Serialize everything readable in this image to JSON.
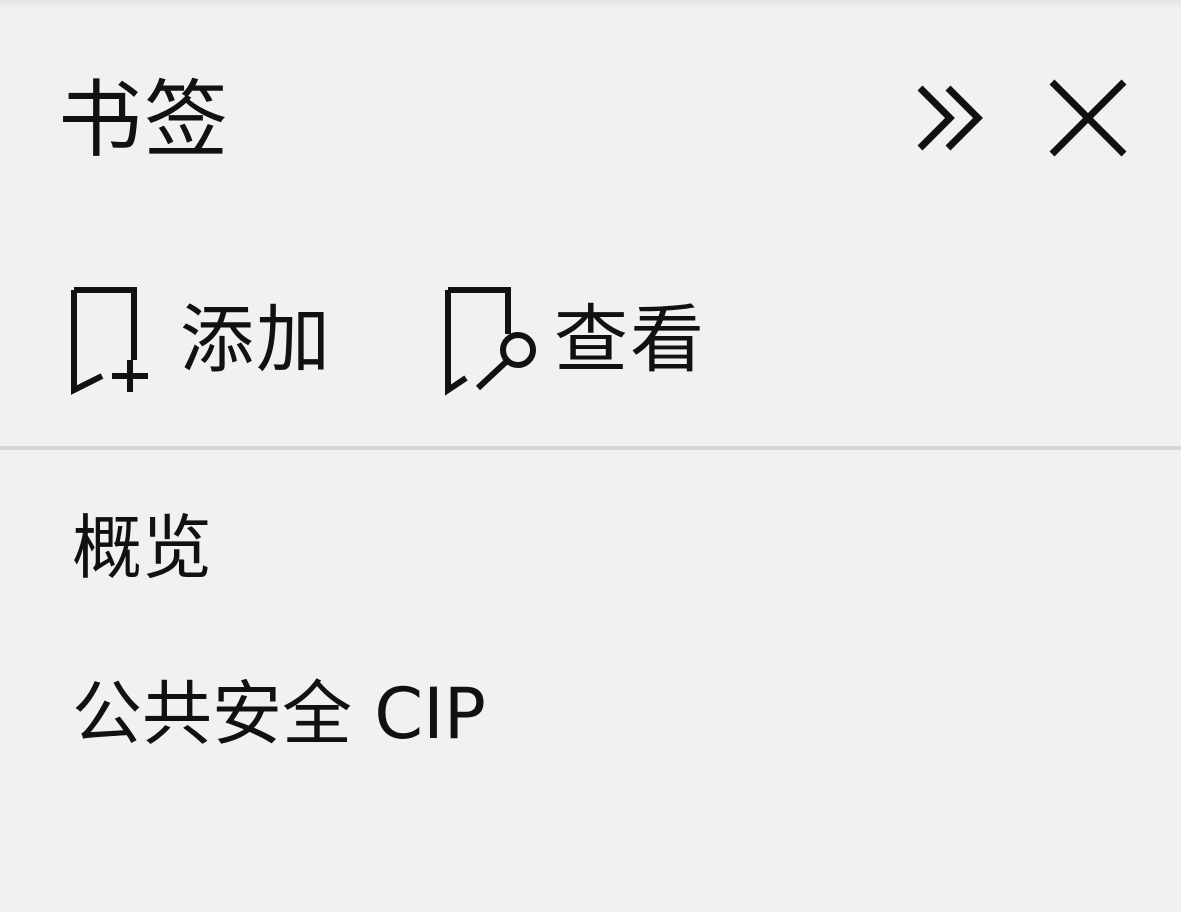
{
  "panel": {
    "title": "书签"
  },
  "header_buttons": {
    "expand_icon": "double-chevron-right-icon",
    "close_icon": "close-icon"
  },
  "toolbar": {
    "add_label": "添加",
    "add_icon": "bookmark-add-icon",
    "view_label": "查看",
    "view_icon": "bookmark-search-icon"
  },
  "bookmarks": [
    {
      "label": "概览"
    },
    {
      "label": "公共安全 CIP"
    }
  ]
}
